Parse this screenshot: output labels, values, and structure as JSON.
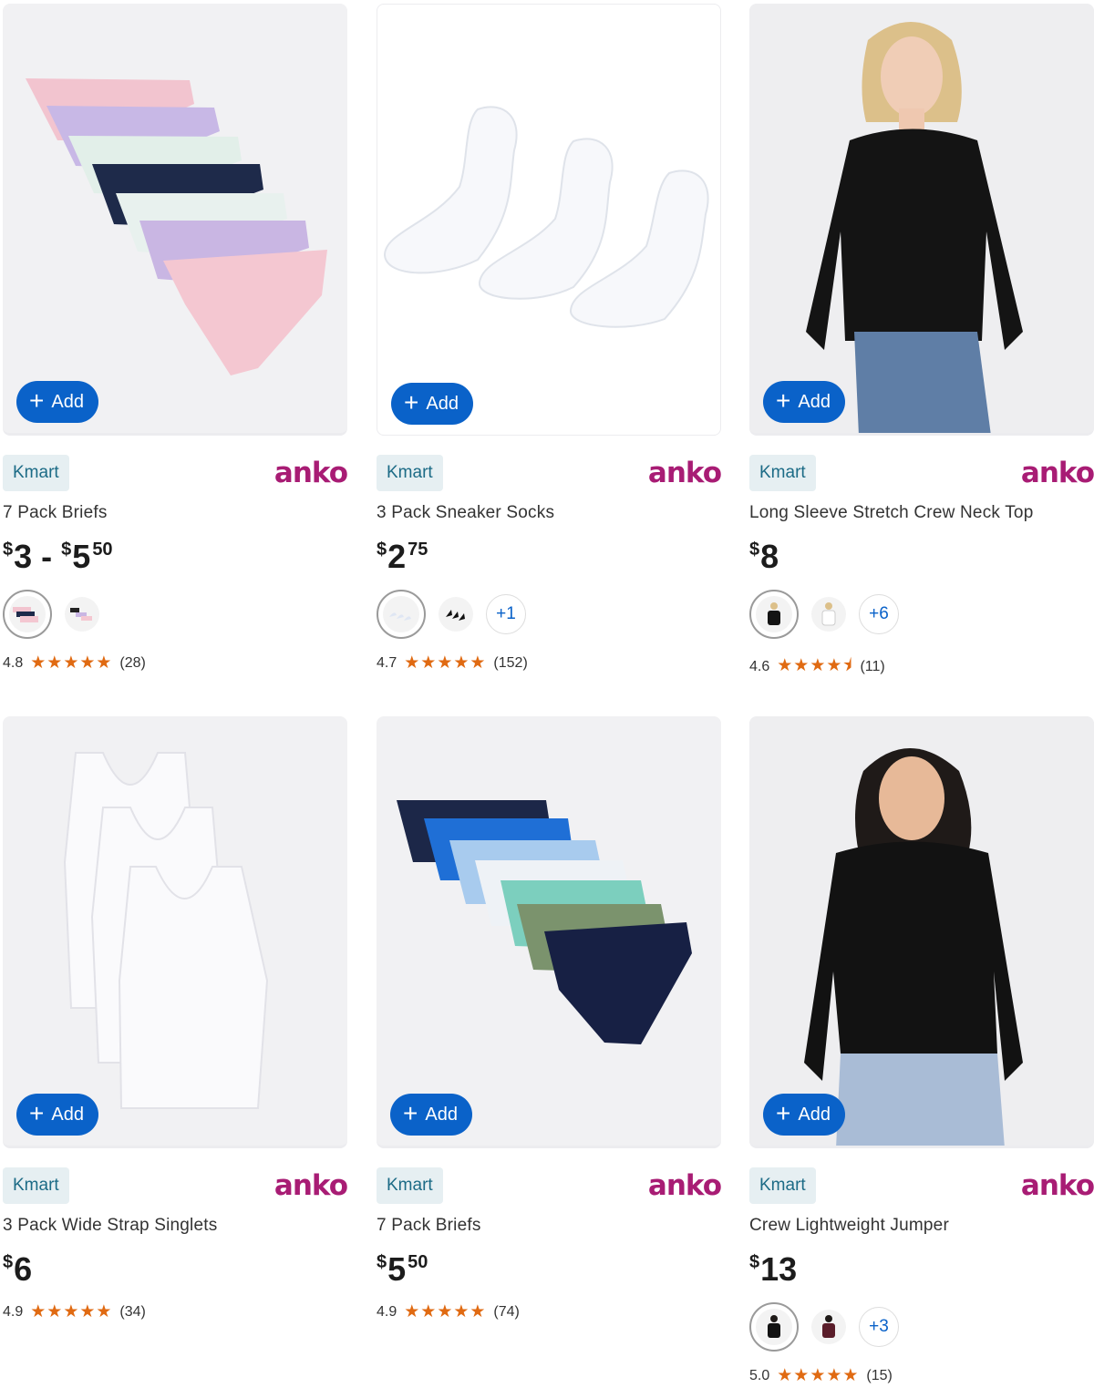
{
  "products": [
    {
      "add_label": "Add",
      "retailer": "Kmart",
      "brand": "anko",
      "title": "7 Pack Briefs",
      "price": {
        "from_dollars": "3",
        "to_dollars": "5",
        "to_cents": "50",
        "currency": "$"
      },
      "rating": "4.8",
      "stars": "★★★★★",
      "reviews": "(28)",
      "swatch_more": ""
    },
    {
      "add_label": "Add",
      "retailer": "Kmart",
      "brand": "anko",
      "title": "3 Pack Sneaker Socks",
      "price": {
        "dollars": "2",
        "cents": "75",
        "currency": "$"
      },
      "rating": "4.7",
      "stars": "★★★★★",
      "reviews": "(152)",
      "swatch_more": "+1"
    },
    {
      "add_label": "Add",
      "retailer": "Kmart",
      "brand": "anko",
      "title": "Long Sleeve Stretch Crew Neck Top",
      "price": {
        "dollars": "8",
        "currency": "$"
      },
      "rating": "4.6",
      "stars": "★★★★⯨",
      "reviews": "(11)",
      "swatch_more": "+6"
    },
    {
      "add_label": "Add",
      "retailer": "Kmart",
      "brand": "anko",
      "title": "3 Pack Wide Strap Singlets",
      "price": {
        "dollars": "6",
        "currency": "$"
      },
      "rating": "4.9",
      "stars": "★★★★★",
      "reviews": "(34)"
    },
    {
      "add_label": "Add",
      "retailer": "Kmart",
      "brand": "anko",
      "title": "7 Pack Briefs",
      "price": {
        "dollars": "5",
        "cents": "50",
        "currency": "$"
      },
      "rating": "4.9",
      "stars": "★★★★★",
      "reviews": "(74)"
    },
    {
      "add_label": "Add",
      "retailer": "Kmart",
      "brand": "anko",
      "title": "Crew Lightweight Jumper",
      "price": {
        "dollars": "13",
        "currency": "$"
      },
      "rating": "5.0",
      "stars": "★★★★★",
      "reviews": "(15)",
      "swatch_more": "+3"
    }
  ],
  "colors": {
    "accent": "#0a62c9",
    "brand": "#a81c74",
    "badge_bg": "#e6eff2",
    "star": "#e06a12"
  },
  "icons": {
    "add": "plus-icon",
    "star": "star-icon"
  }
}
